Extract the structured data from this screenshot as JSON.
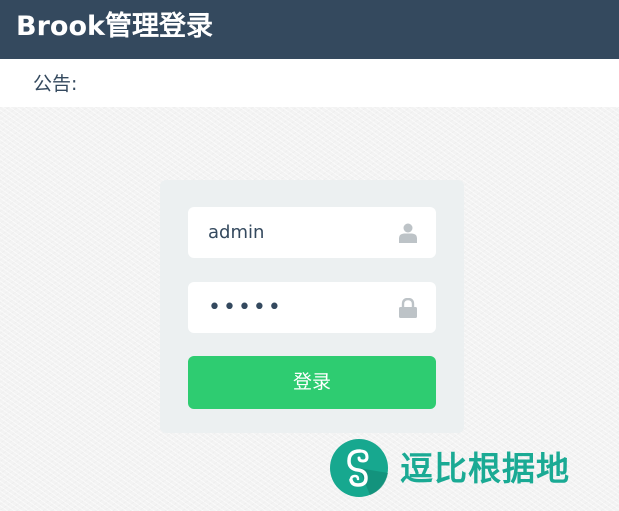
{
  "header": {
    "title": "Brook管理登录"
  },
  "notice": {
    "label": "公告:"
  },
  "login": {
    "username_value": "admin",
    "password_value": "•••••",
    "button_label": "登录",
    "username_icon": "user-icon",
    "password_icon": "lock-icon"
  },
  "watermark": {
    "text": "逗比根据地",
    "logo_icon": "swirl-logo-icon"
  },
  "colors": {
    "header_bg": "#34495e",
    "button_bg": "#2ecc71",
    "box_bg": "#ecf0f1",
    "watermark_green": "#1aaa94"
  }
}
